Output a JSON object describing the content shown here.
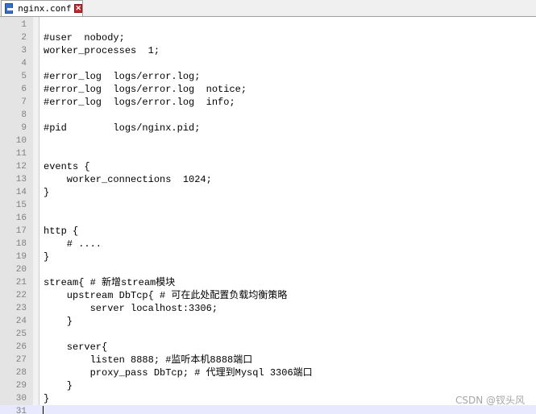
{
  "tab": {
    "filename": "nginx.conf",
    "close_glyph": "✕"
  },
  "editor": {
    "lines": [
      {
        "num": "1",
        "text": ""
      },
      {
        "num": "2",
        "text": "#user  nobody;"
      },
      {
        "num": "3",
        "text": "worker_processes  1;"
      },
      {
        "num": "4",
        "text": ""
      },
      {
        "num": "5",
        "text": "#error_log  logs/error.log;"
      },
      {
        "num": "6",
        "text": "#error_log  logs/error.log  notice;"
      },
      {
        "num": "7",
        "text": "#error_log  logs/error.log  info;"
      },
      {
        "num": "8",
        "text": ""
      },
      {
        "num": "9",
        "text": "#pid        logs/nginx.pid;"
      },
      {
        "num": "10",
        "text": ""
      },
      {
        "num": "11",
        "text": ""
      },
      {
        "num": "12",
        "text": "events {"
      },
      {
        "num": "13",
        "text": "    worker_connections  1024;"
      },
      {
        "num": "14",
        "text": "}"
      },
      {
        "num": "15",
        "text": ""
      },
      {
        "num": "16",
        "text": ""
      },
      {
        "num": "17",
        "text": "http {"
      },
      {
        "num": "18",
        "text": "    # ...."
      },
      {
        "num": "19",
        "text": "}"
      },
      {
        "num": "20",
        "text": ""
      },
      {
        "num": "21",
        "text": "stream{ # 新增stream模块"
      },
      {
        "num": "22",
        "text": "    upstream DbTcp{ # 可在此处配置负载均衡策略"
      },
      {
        "num": "23",
        "text": "        server localhost:3306;"
      },
      {
        "num": "24",
        "text": "    }"
      },
      {
        "num": "25",
        "text": ""
      },
      {
        "num": "26",
        "text": "    server{"
      },
      {
        "num": "27",
        "text": "        listen 8888; #监听本机8888端口"
      },
      {
        "num": "28",
        "text": "        proxy_pass DbTcp; # 代理到Mysql 3306端口"
      },
      {
        "num": "29",
        "text": "    }"
      },
      {
        "num": "30",
        "text": "}"
      },
      {
        "num": "31",
        "text": ""
      }
    ]
  },
  "watermark": "CSDN @钗头风"
}
